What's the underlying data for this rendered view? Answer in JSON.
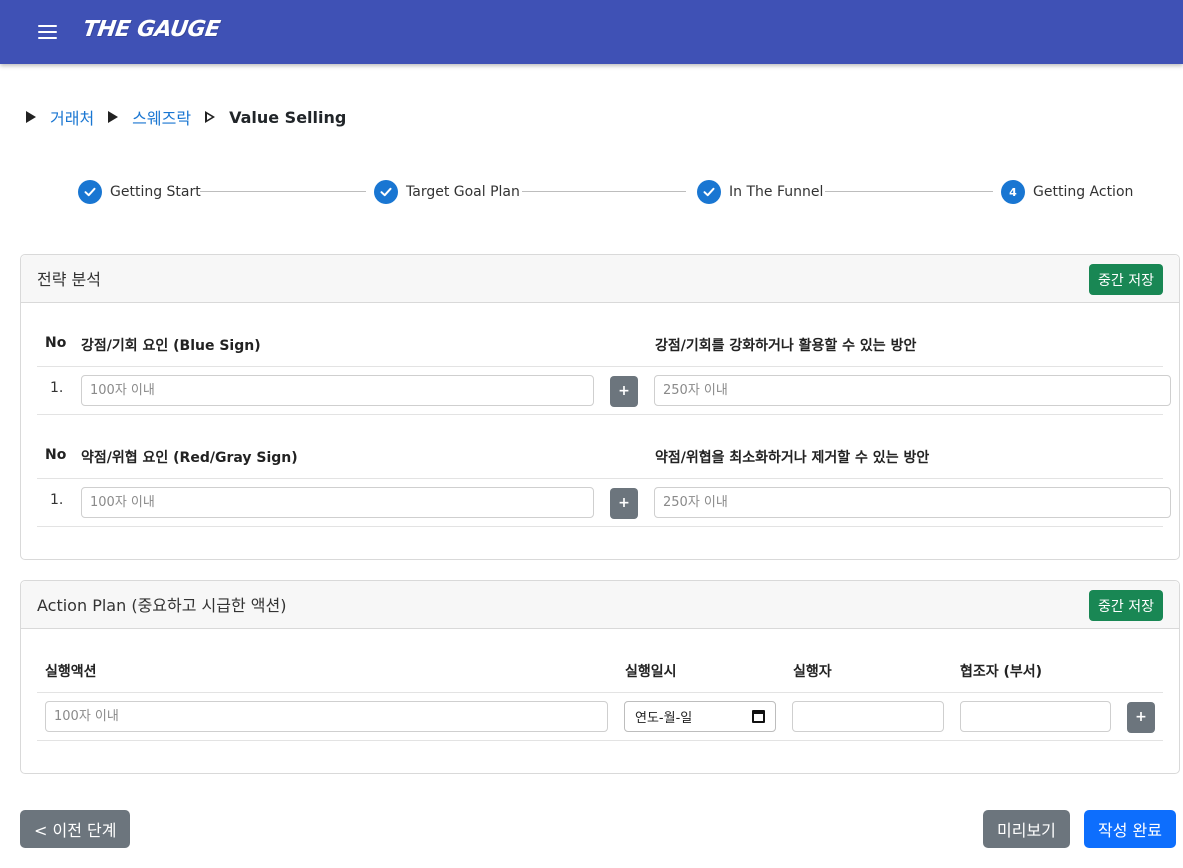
{
  "header": {
    "logo_text": "THE GAUGE",
    "menu_icon": "hamburger-menu-icon",
    "bg_color": "#3f51b5"
  },
  "breadcrumb": {
    "items": [
      "거래처",
      "스웨즈락"
    ],
    "current": "Value Selling"
  },
  "stepper": {
    "steps": [
      {
        "label": "Getting Start",
        "state": "done",
        "icon": "check-icon"
      },
      {
        "label": "Target Goal Plan",
        "state": "done",
        "icon": "check-icon"
      },
      {
        "label": "In The Funnel",
        "state": "done",
        "icon": "check-icon"
      },
      {
        "label": "Getting Action",
        "state": "active",
        "number": "4"
      }
    ],
    "color": "#1976d2"
  },
  "strategy": {
    "title": "전략 분석",
    "save_label": "중간 저장",
    "blue": {
      "no_header": "No",
      "factor_header": "강점/기회 요인 (Blue Sign)",
      "plan_header": "강점/기회를 강화하거나 활용할 수 있는 방안",
      "row_no": "1.",
      "factor_placeholder": "100자 이내",
      "plan_placeholder": "250자 이내",
      "add_label": "+"
    },
    "red": {
      "no_header": "No",
      "factor_header": "약점/위협 요인 (Red/Gray Sign)",
      "plan_header": "약점/위협을 최소화하거나 제거할 수 있는 방안",
      "row_no": "1.",
      "factor_placeholder": "100자 이내",
      "plan_placeholder": "250자 이내",
      "add_label": "+"
    }
  },
  "action_plan": {
    "title": "Action Plan (중요하고 시급한 액션)",
    "save_label": "중간 저장",
    "headers": {
      "action": "실행액션",
      "date": "실행일시",
      "executor": "실행자",
      "collaborator": "협조자 (부서)"
    },
    "action_placeholder": "100자 이내",
    "date_placeholder": "연도-월-일",
    "add_label": "+"
  },
  "footer": {
    "prev_label": "< 이전 단계",
    "preview_label": "미리보기",
    "done_label": "작성 완료"
  },
  "colors": {
    "save_green": "#198754",
    "secondary": "#6c757d",
    "primary": "#0d6efd"
  }
}
